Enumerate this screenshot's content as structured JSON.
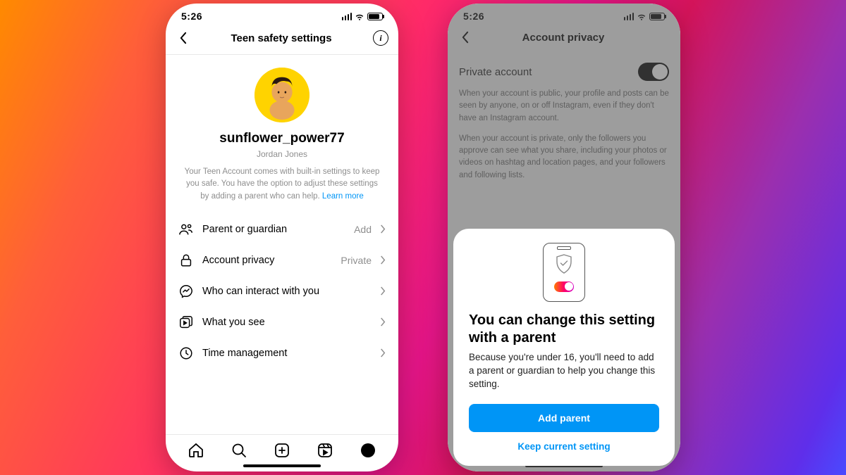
{
  "status": {
    "time": "5:26"
  },
  "phone1": {
    "headerTitle": "Teen safety settings",
    "username": "sunflower_power77",
    "realName": "Jordan Jones",
    "description": "Your Teen Account comes with built-in settings to keep you safe. You have the option to adjust these settings by adding a parent who can help. ",
    "learnMore": "Learn more",
    "menu": {
      "parent": {
        "label": "Parent or guardian",
        "value": "Add"
      },
      "privacy": {
        "label": "Account privacy",
        "value": "Private"
      },
      "interact": {
        "label": "Who can interact with you"
      },
      "see": {
        "label": "What you see"
      },
      "time": {
        "label": "Time management"
      }
    }
  },
  "phone2": {
    "headerTitle": "Account privacy",
    "privateLabel": "Private account",
    "desc1": "When your account is public, your profile and posts can be seen by anyone, on or off Instagram, even if they don't have an Instagram account.",
    "desc2": "When your account is private, only the followers you approve can see what you share, including your photos or videos on hashtag and location pages, and your followers and following lists.",
    "sheet": {
      "title": "You can change this setting with a parent",
      "desc": "Because you're under 16, you'll need to add a parent or guardian to help you change this setting.",
      "primary": "Add parent",
      "secondary": "Keep current setting"
    }
  }
}
